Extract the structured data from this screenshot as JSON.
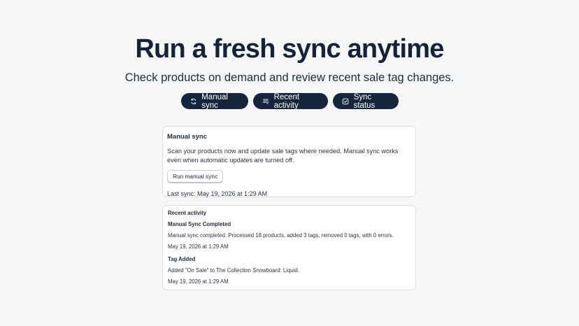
{
  "hero": {
    "title": "Run a fresh sync anytime",
    "subtitle": "Check products on demand and review recent sale tag changes."
  },
  "nav": {
    "items": [
      {
        "label": "Manual sync",
        "icon": "refresh-icon"
      },
      {
        "label": "Recent activity",
        "icon": "list-icon"
      },
      {
        "label": "Sync status",
        "icon": "check-square-icon"
      }
    ]
  },
  "manual_card": {
    "title": "Manual sync",
    "description": "Scan your products now and update sale tags where needed. Manual sync works even when automatic updates are turned off.",
    "button_label": "Run manual sync",
    "last_sync": "Last sync: May 19, 2026 at 1:29 AM"
  },
  "activity_card": {
    "title": "Recent activity",
    "items": [
      {
        "title": "Manual Sync Completed",
        "description": "Manual sync completed. Processed 18 products, added 3 tags, removed 0 tags, with 0 errors.",
        "date": "May 19, 2026 at 1:29 AM"
      },
      {
        "title": "Tag Added",
        "description": "Added \"On Sale\" to The Collection Snowboard: Liquid.",
        "date": "May 19, 2026 at 1:29 AM"
      }
    ]
  },
  "colors": {
    "background": "#f6f7f9",
    "pill": "#15253b",
    "title": "#14233a"
  }
}
